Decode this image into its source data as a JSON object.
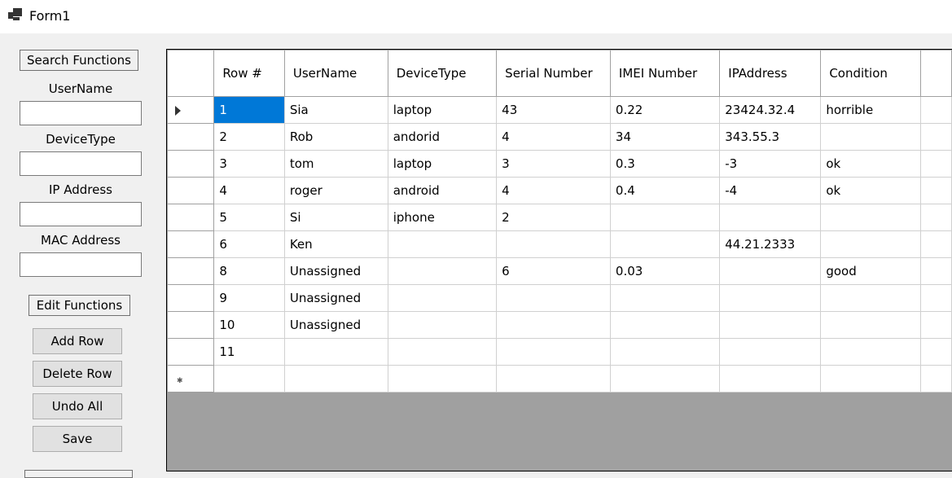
{
  "window": {
    "title": "Form1"
  },
  "left": {
    "search_group": "Search Functions",
    "fields": [
      {
        "label": "UserName",
        "value": ""
      },
      {
        "label": "DeviceType",
        "value": ""
      },
      {
        "label": "IP Address",
        "value": ""
      },
      {
        "label": "MAC Address",
        "value": ""
      }
    ],
    "edit_group": "Edit Functions",
    "buttons": {
      "add": "Add Row",
      "delete": "Delete Row",
      "undo": "Undo All",
      "save": "Save"
    }
  },
  "grid": {
    "columns": [
      "Row #",
      "UserName",
      "DeviceType",
      "Serial Number",
      "IMEI Number",
      "IPAddress",
      "Condition",
      ""
    ],
    "rows": [
      [
        "1",
        "Sia",
        "laptop",
        "43",
        "0.22",
        "23424.32.4",
        "horrible",
        ""
      ],
      [
        "2",
        "Rob",
        "andorid",
        "4",
        "34",
        "343.55.3",
        "",
        ""
      ],
      [
        "3",
        "tom",
        "laptop",
        "3",
        "0.3",
        "-3",
        "ok",
        ""
      ],
      [
        "4",
        "roger",
        "android",
        "4",
        "0.4",
        "-4",
        "ok",
        ""
      ],
      [
        "5",
        "Si",
        "iphone",
        "2",
        "",
        "",
        "",
        ""
      ],
      [
        "6",
        "Ken",
        "",
        "",
        "",
        "44.21.2333",
        "",
        ""
      ],
      [
        "8",
        "Unassigned",
        "",
        "6",
        "0.03",
        "",
        "good",
        ""
      ],
      [
        "9",
        "Unassigned",
        "",
        "",
        "",
        "",
        "",
        ""
      ],
      [
        "10",
        "Unassigned",
        "",
        "",
        "",
        "",
        "",
        ""
      ],
      [
        "11",
        "",
        "",
        "",
        "",
        "",
        "",
        ""
      ]
    ],
    "selected_color": "#0078d7"
  }
}
